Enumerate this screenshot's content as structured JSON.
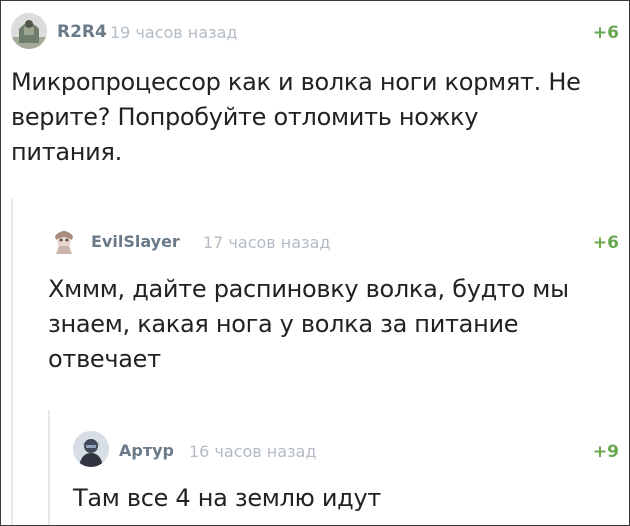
{
  "comments": [
    {
      "author": "R2R4",
      "time": "19 часов назад",
      "rating": "+6",
      "text": "Микропроцессор как и волка ноги кормят. Не верите? Попробуйте отломить ножку питания."
    },
    {
      "author": "EvilSlayer",
      "time": "17 часов назад",
      "rating": "+6",
      "text": "Хммм, дайте распиновку волка, будто мы знаем, какая нога у волка за питание отвечает"
    },
    {
      "author": "Артур",
      "time": "16 часов назад",
      "rating": "+9",
      "text": "Там все 4 на землю идут"
    }
  ],
  "colors": {
    "author": "#6b7a89",
    "time": "#b3bcc4",
    "rating": "#6aa84f",
    "branch": "#e5e9ed",
    "text": "#222222"
  }
}
